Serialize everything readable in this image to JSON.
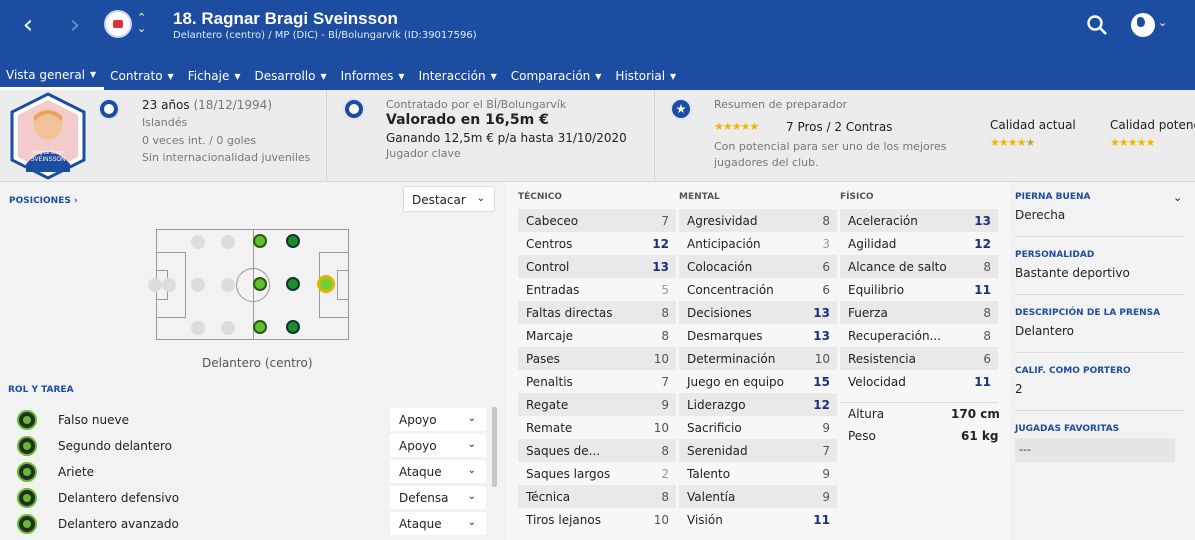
{
  "header": {
    "title": "18. Ragnar Bragi Sveinsson",
    "subtitle": "Delantero (centro) / MP (DIC) - BÍ/Bolungarvík (ID:39017596)"
  },
  "menu": [
    "Vista general",
    "Contrato",
    "Fichaje",
    "Desarrollo",
    "Informes",
    "Interacción",
    "Comparación",
    "Historial"
  ],
  "info": {
    "age": "23 años",
    "dob": "(18/12/1994)",
    "nationality": "Islandés",
    "caps": "0 veces int. / 0 goles",
    "youth": "Sin internacionalidad juveniles",
    "contract_by": "Contratado por el BÍ/Bolungarvík",
    "value": "Valorado en 16,5m €",
    "wage": "Ganando 12,5m € p/a hasta 31/10/2020",
    "status": "Jugador clave",
    "coach_title": "Resumen de preparador",
    "pros_cons": "7 Pros / 2 Contras",
    "coach_text1": "Con potencial para ser uno de los mejores",
    "coach_text2": "jugadores del club.",
    "current_label": "Calidad actual",
    "potential_label": "Calidad potencial",
    "current_stars": 4.5,
    "potential_stars": 5,
    "portrait_name1": "Ragnar Bragi",
    "portrait_name2": "SVEINSSON"
  },
  "positions": {
    "link": "POSICIONES ›",
    "highlight": "Destacar",
    "label": "Delantero (centro)"
  },
  "roles": {
    "title": "ROL Y TAREA",
    "items": [
      {
        "name": "Falso nueve",
        "duty": "Apoyo"
      },
      {
        "name": "Segundo delantero",
        "duty": "Apoyo"
      },
      {
        "name": "Ariete",
        "duty": "Ataque"
      },
      {
        "name": "Delantero defensivo",
        "duty": "Defensa"
      },
      {
        "name": "Delantero avanzado",
        "duty": "Ataque"
      }
    ]
  },
  "attributes": {
    "tecnico_title": "TÉCNICO",
    "mental_title": "MENTAL",
    "fisico_title": "FÍSICO",
    "tecnico": [
      [
        "Cabeceo",
        "7"
      ],
      [
        "Centros",
        "12"
      ],
      [
        "Control",
        "13"
      ],
      [
        "Entradas",
        "5"
      ],
      [
        "Faltas directas",
        "8"
      ],
      [
        "Marcaje",
        "8"
      ],
      [
        "Pases",
        "10"
      ],
      [
        "Penaltis",
        "7"
      ],
      [
        "Regate",
        "9"
      ],
      [
        "Remate",
        "10"
      ],
      [
        "Saques de...",
        "8"
      ],
      [
        "Saques largos",
        "2"
      ],
      [
        "Técnica",
        "8"
      ],
      [
        "Tiros lejanos",
        "10"
      ]
    ],
    "mental": [
      [
        "Agresividad",
        "8"
      ],
      [
        "Anticipación",
        "3"
      ],
      [
        "Colocación",
        "6"
      ],
      [
        "Concentración",
        "6"
      ],
      [
        "Decisiones",
        "13"
      ],
      [
        "Desmarques",
        "13"
      ],
      [
        "Determinación",
        "10"
      ],
      [
        "Juego en equipo",
        "15"
      ],
      [
        "Liderazgo",
        "12"
      ],
      [
        "Sacrificio",
        "9"
      ],
      [
        "Serenidad",
        "7"
      ],
      [
        "Talento",
        "9"
      ],
      [
        "Valentía",
        "9"
      ],
      [
        "Visión",
        "11"
      ]
    ],
    "fisico": [
      [
        "Aceleración",
        "13"
      ],
      [
        "Agilidad",
        "12"
      ],
      [
        "Alcance de salto",
        "8"
      ],
      [
        "Equilibrio",
        "11"
      ],
      [
        "Fuerza",
        "8"
      ],
      [
        "Recuperación...",
        "8"
      ],
      [
        "Resistencia",
        "6"
      ],
      [
        "Velocidad",
        "11"
      ]
    ],
    "height_label": "Altura",
    "height": "170 cm",
    "weight_label": "Peso",
    "weight": "61 kg"
  },
  "side": {
    "foot_label": "PIERNA BUENA",
    "foot": "Derecha",
    "personality_label": "PERSONALIDAD",
    "personality": "Bastante deportivo",
    "press_label": "DESCRIPCIÓN DE LA PRENSA",
    "press": "Delantero",
    "gk_label": "CALIF. COMO PORTERO",
    "gk": "2",
    "moves_label": "JUGADAS FAVORITAS",
    "moves": "---"
  },
  "colors": {
    "accent": "#1c4da0",
    "star": "#f2b600",
    "highlight": "#1c2f7a"
  }
}
